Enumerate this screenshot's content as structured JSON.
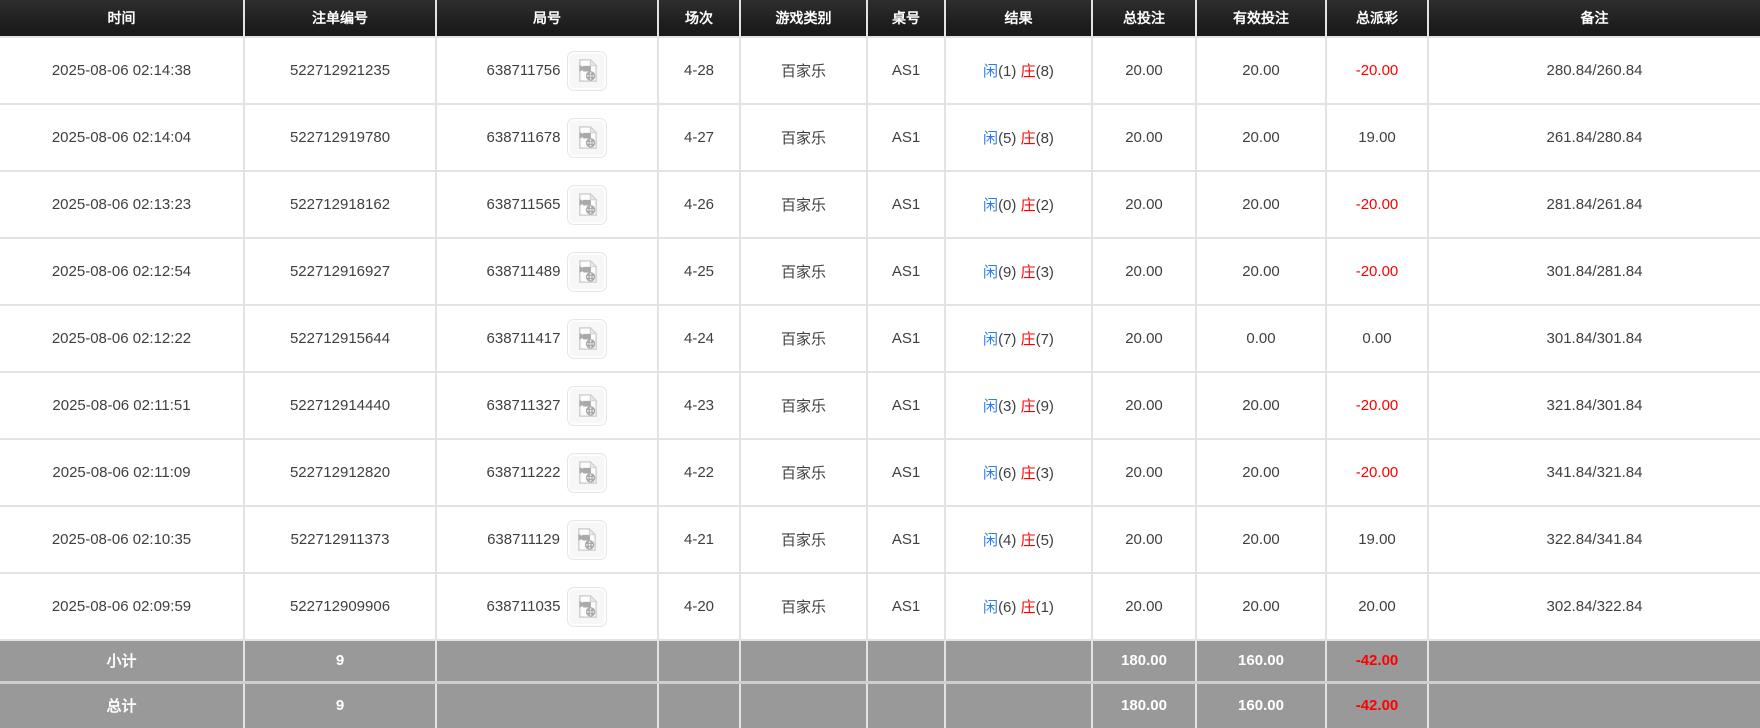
{
  "table": {
    "columns": [
      "时间",
      "注单编号",
      "局号",
      "场次",
      "游戏类别",
      "桌号",
      "结果",
      "总投注",
      "有效投注",
      "总派彩",
      "备注"
    ],
    "result_labels": {
      "player": "闲",
      "banker": "庄"
    },
    "icons": {
      "video_replay": "video-replay-icon"
    },
    "colors": {
      "accent_blue": "#2b7bf5",
      "accent_red": "#ff0000",
      "header_bg": "#1e1e1e",
      "summary_bg": "#999999"
    },
    "rows": [
      {
        "time": "2025-08-06 02:14:38",
        "bet_id": "522712921235",
        "round_id": "638711756",
        "session": "4-28",
        "game_type": "百家乐",
        "table_no": "AS1",
        "player_score": "(1)",
        "banker_score": "(8)",
        "total_bet": "20.00",
        "valid_bet": "20.00",
        "payout": "-20.00",
        "remark": "280.84/260.84"
      },
      {
        "time": "2025-08-06 02:14:04",
        "bet_id": "522712919780",
        "round_id": "638711678",
        "session": "4-27",
        "game_type": "百家乐",
        "table_no": "AS1",
        "player_score": "(5)",
        "banker_score": "(8)",
        "total_bet": "20.00",
        "valid_bet": "20.00",
        "payout": "19.00",
        "remark": "261.84/280.84"
      },
      {
        "time": "2025-08-06 02:13:23",
        "bet_id": "522712918162",
        "round_id": "638711565",
        "session": "4-26",
        "game_type": "百家乐",
        "table_no": "AS1",
        "player_score": "(0)",
        "banker_score": "(2)",
        "total_bet": "20.00",
        "valid_bet": "20.00",
        "payout": "-20.00",
        "remark": "281.84/261.84"
      },
      {
        "time": "2025-08-06 02:12:54",
        "bet_id": "522712916927",
        "round_id": "638711489",
        "session": "4-25",
        "game_type": "百家乐",
        "table_no": "AS1",
        "player_score": "(9)",
        "banker_score": "(3)",
        "total_bet": "20.00",
        "valid_bet": "20.00",
        "payout": "-20.00",
        "remark": "301.84/281.84"
      },
      {
        "time": "2025-08-06 02:12:22",
        "bet_id": "522712915644",
        "round_id": "638711417",
        "session": "4-24",
        "game_type": "百家乐",
        "table_no": "AS1",
        "player_score": "(7)",
        "banker_score": "(7)",
        "total_bet": "20.00",
        "valid_bet": "0.00",
        "payout": "0.00",
        "remark": "301.84/301.84"
      },
      {
        "time": "2025-08-06 02:11:51",
        "bet_id": "522712914440",
        "round_id": "638711327",
        "session": "4-23",
        "game_type": "百家乐",
        "table_no": "AS1",
        "player_score": "(3)",
        "banker_score": "(9)",
        "total_bet": "20.00",
        "valid_bet": "20.00",
        "payout": "-20.00",
        "remark": "321.84/301.84"
      },
      {
        "time": "2025-08-06 02:11:09",
        "bet_id": "522712912820",
        "round_id": "638711222",
        "session": "4-22",
        "game_type": "百家乐",
        "table_no": "AS1",
        "player_score": "(6)",
        "banker_score": "(3)",
        "total_bet": "20.00",
        "valid_bet": "20.00",
        "payout": "-20.00",
        "remark": "341.84/321.84"
      },
      {
        "time": "2025-08-06 02:10:35",
        "bet_id": "522712911373",
        "round_id": "638711129",
        "session": "4-21",
        "game_type": "百家乐",
        "table_no": "AS1",
        "player_score": "(4)",
        "banker_score": "(5)",
        "total_bet": "20.00",
        "valid_bet": "20.00",
        "payout": "19.00",
        "remark": "322.84/341.84"
      },
      {
        "time": "2025-08-06 02:09:59",
        "bet_id": "522712909906",
        "round_id": "638711035",
        "session": "4-20",
        "game_type": "百家乐",
        "table_no": "AS1",
        "player_score": "(6)",
        "banker_score": "(1)",
        "total_bet": "20.00",
        "valid_bet": "20.00",
        "payout": "20.00",
        "remark": "302.84/322.84"
      }
    ],
    "subtotal": {
      "label": "小计",
      "count": "9",
      "total_bet": "180.00",
      "valid_bet": "160.00",
      "payout": "-42.00"
    },
    "grand_total": {
      "label": "总计",
      "count": "9",
      "total_bet": "180.00",
      "valid_bet": "160.00",
      "payout": "-42.00"
    }
  }
}
